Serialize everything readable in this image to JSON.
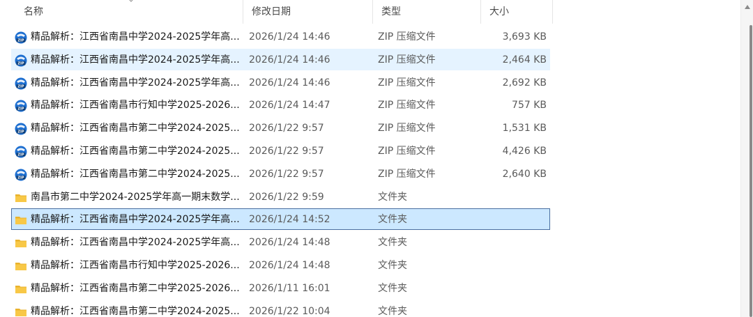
{
  "columns": {
    "name": "名称",
    "date": "修改日期",
    "type": "类型",
    "size": "大小"
  },
  "rows": [
    {
      "icon": "zip-archive-icon",
      "name": "精品解析：江西省南昌中学2024-2025学年高...",
      "date": "2026/1/24 14:46",
      "type": "ZIP 压缩文件",
      "size": "3,693 KB",
      "state": "normal"
    },
    {
      "icon": "zip-archive-icon",
      "name": "精品解析：江西省南昌中学2024-2025学年高...",
      "date": "2026/1/24 14:46",
      "type": "ZIP 压缩文件",
      "size": "2,464 KB",
      "state": "hover"
    },
    {
      "icon": "zip-archive-icon",
      "name": "精品解析：江西省南昌中学2024-2025学年高...",
      "date": "2026/1/24 14:46",
      "type": "ZIP 压缩文件",
      "size": "2,692 KB",
      "state": "normal"
    },
    {
      "icon": "zip-archive-icon",
      "name": "精品解析：江西省南昌市行知中学2025-2026...",
      "date": "2026/1/24 14:47",
      "type": "ZIP 压缩文件",
      "size": "757 KB",
      "state": "normal"
    },
    {
      "icon": "zip-archive-icon",
      "name": "精品解析：江西省南昌市第二中学2024-2025...",
      "date": "2026/1/22 9:57",
      "type": "ZIP 压缩文件",
      "size": "1,531 KB",
      "state": "normal"
    },
    {
      "icon": "zip-archive-icon",
      "name": "精品解析：江西省南昌市第二中学2024-2025...",
      "date": "2026/1/22 9:57",
      "type": "ZIP 压缩文件",
      "size": "4,426 KB",
      "state": "normal"
    },
    {
      "icon": "zip-archive-icon",
      "name": "精品解析：江西省南昌市第二中学2024-2025...",
      "date": "2026/1/22 9:57",
      "type": "ZIP 压缩文件",
      "size": "2,640 KB",
      "state": "normal"
    },
    {
      "icon": "folder-icon",
      "name": "南昌市第二中学2024-2025学年高一期末数学...",
      "date": "2026/1/22 9:59",
      "type": "文件夹",
      "size": "",
      "state": "normal"
    },
    {
      "icon": "folder-icon",
      "name": "精品解析：江西省南昌中学2024-2025学年高...",
      "date": "2026/1/24 14:52",
      "type": "文件夹",
      "size": "",
      "state": "selected"
    },
    {
      "icon": "folder-icon",
      "name": "精品解析：江西省南昌中学2024-2025学年高...",
      "date": "2026/1/24 14:48",
      "type": "文件夹",
      "size": "",
      "state": "normal"
    },
    {
      "icon": "folder-icon",
      "name": "精品解析：江西省南昌市行知中学2025-2026...",
      "date": "2026/1/24 14:48",
      "type": "文件夹",
      "size": "",
      "state": "normal"
    },
    {
      "icon": "folder-icon",
      "name": "精品解析：江西省南昌市第二中学2025-2026...",
      "date": "2026/1/11 16:01",
      "type": "文件夹",
      "size": "",
      "state": "normal"
    },
    {
      "icon": "folder-icon",
      "name": "精品解析：江西省南昌市第二中学2024-2025...",
      "date": "2026/1/22 10:04",
      "type": "文件夹",
      "size": "",
      "state": "normal"
    }
  ],
  "colors": {
    "hover": "#e5f3ff",
    "selected": "#cce8ff",
    "selected_border": "#4a6fa0",
    "zip_icon_blue": "#1e6fd0",
    "folder_yellow": "#f8c847"
  }
}
